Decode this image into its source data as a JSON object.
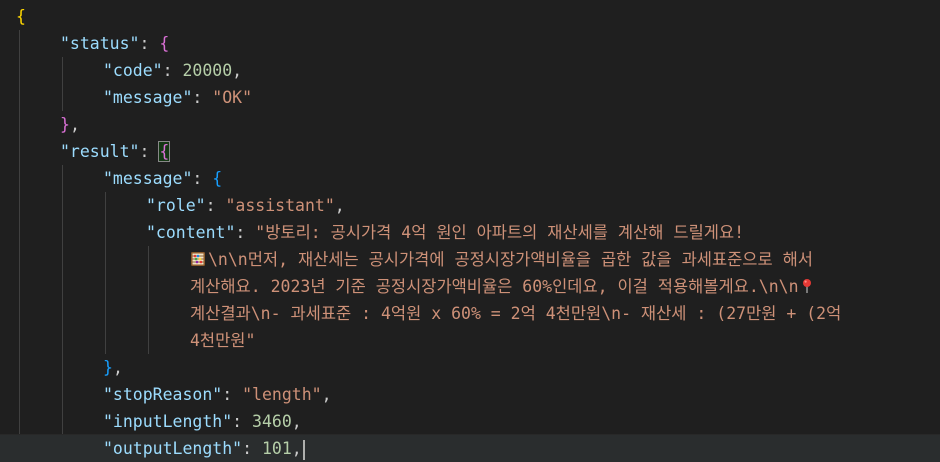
{
  "json": {
    "open_brace": "{",
    "status_key": "\"status\"",
    "code_key": "\"code\"",
    "code_value": "20000",
    "message_key": "\"message\"",
    "message_value": "\"OK\"",
    "result_key": "\"result\"",
    "role_key": "\"role\"",
    "role_value": "\"assistant\"",
    "content_key": "\"content\"",
    "content_lines": [
      "\"방토리: 공시가격 4억 원인 아파트의 재산세를 계산해 드릴게요!",
      "\\n\\n먼저, 재산세는 공시가격에 공정시장가액비율을 곱한 값을 과세표준으로 해서",
      "계산해요. 2023년 기준 공정시장가액비율은 60%인데요, 이걸 적용해볼게요.\\n\\n",
      "계산결과\\n- 과세표준 : 4억원 x 60% = 2억 4천만원\\n- 재산세 : (27만원 + (2억",
      "4천만원\""
    ],
    "stop_reason_key": "\"stopReason\"",
    "stop_reason_value": "\"length\"",
    "input_length_key": "\"inputLength\"",
    "input_length_value": "3460",
    "output_length_key": "\"outputLength\"",
    "output_length_value": "101"
  },
  "icons": {
    "abacus": "abacus-emoji-icon",
    "pin": "round-pushpin-emoji-icon"
  },
  "colors": {
    "background": "#1f1f1f",
    "key": "#9cdcfe",
    "string": "#ce9178",
    "number": "#b5cea8",
    "bracket_level1": "#ffd700",
    "bracket_level2": "#da70d6",
    "bracket_level3": "#179fff"
  }
}
